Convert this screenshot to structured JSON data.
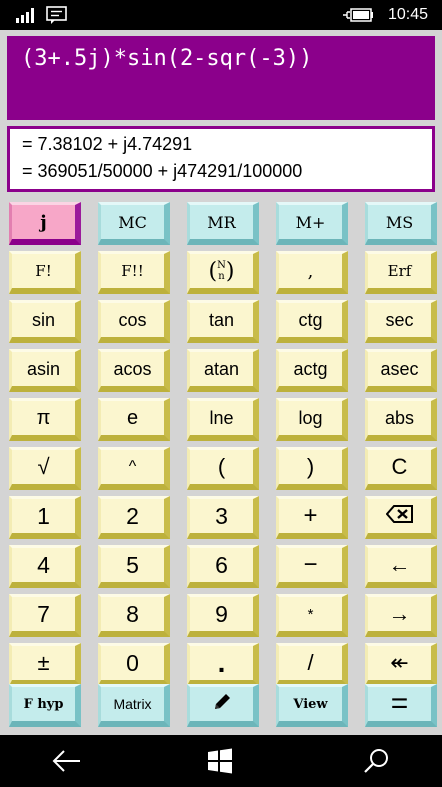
{
  "status_bar": {
    "time": "10:45"
  },
  "display": {
    "expression": "(3+.5j)*sin(2-sqr(-3))",
    "result_decimal": "= 7.38102 + j4.74291",
    "result_fraction": "= 369051/50000 + j474291/100000"
  },
  "keys": {
    "j": "j",
    "mc": "MC",
    "mr": "MR",
    "mplus": "M+",
    "ms": "MS",
    "fact": "F!",
    "dfact": "F!!",
    "binom_n": "N",
    "binom_k": "n",
    "comma": ",",
    "erf": "Erf",
    "sin": "sin",
    "cos": "cos",
    "tan": "tan",
    "ctg": "ctg",
    "sec": "sec",
    "asin": "asin",
    "acos": "acos",
    "atan": "atan",
    "actg": "actg",
    "asec": "asec",
    "pi": "π",
    "e": "e",
    "lne": "lne",
    "log": "log",
    "abs": "abs",
    "sqrt": "√",
    "pow": "^",
    "lparen": "(",
    "rparen": ")",
    "clear": "C",
    "d1": "1",
    "d2": "2",
    "d3": "3",
    "plus": "+",
    "d4": "4",
    "d5": "5",
    "d6": "6",
    "minus": "−",
    "left": "←",
    "d7": "7",
    "d8": "8",
    "d9": "9",
    "mul": "*",
    "right": "→",
    "plusminus": "±",
    "d0": "0",
    "dot": ".",
    "div": "/",
    "home": "↞",
    "fhyp": "F hyp",
    "matrix": "Matrix",
    "view": "View",
    "equals": "="
  },
  "colors": {
    "display_bg": "#8b008b",
    "key_bg": "#fbf6cf",
    "memory_key_bg": "#c4ecec",
    "j_key_bg": "#f7a7c8"
  },
  "icons": {
    "backspace": "backspace-icon",
    "edit": "pencil-icon"
  }
}
